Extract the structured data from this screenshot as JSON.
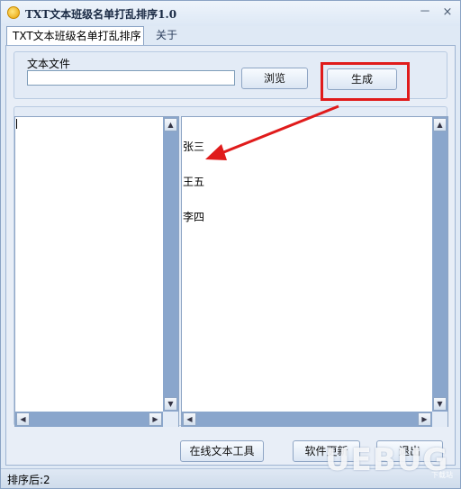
{
  "window": {
    "title": "TXT文本班级名单打乱排序1.0",
    "minimize_glyph": "－",
    "close_glyph": "×"
  },
  "tabs": [
    {
      "label": "TXT文本班级名单打乱排序",
      "active": true
    },
    {
      "label": "关于",
      "active": false
    }
  ],
  "file_group": {
    "label": "文本文件",
    "input_value": "",
    "browse_label": "浏览",
    "generate_label": "生成"
  },
  "left_text": "",
  "right_lines": [
    "张三",
    "王五",
    "李四"
  ],
  "scroll_glyphs": {
    "up": "▲",
    "down": "▼",
    "left": "◀",
    "right": "▶"
  },
  "buttons": {
    "online_tools": "在线文本工具",
    "update": "软件更新",
    "exit": "退出"
  },
  "status": "排序后:2",
  "watermark": {
    "text": "UEBUG",
    "sub": "下载站"
  },
  "colors": {
    "highlight": "#e01b1b",
    "scrollbar": "#8aa6cc",
    "window_bg": "#dfe9f5"
  }
}
